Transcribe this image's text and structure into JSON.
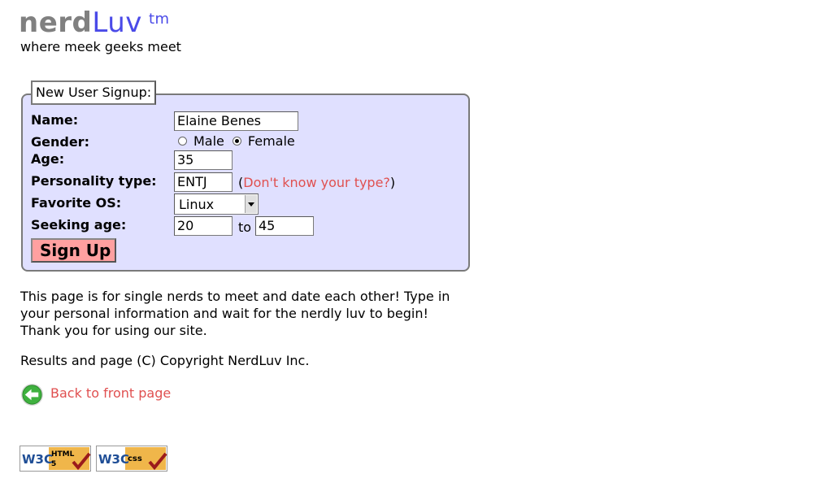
{
  "logo": {
    "nerd": "nerd",
    "luv": "Luv",
    "tm": "tm",
    "tagline": "where meek geeks meet"
  },
  "form": {
    "legend": "New User Signup:",
    "name_label": "Name:",
    "name_value": "Elaine Benes",
    "gender_label": "Gender:",
    "gender_male": "Male",
    "gender_female": "Female",
    "gender_selected": "Female",
    "age_label": "Age:",
    "age_value": "35",
    "personality_label": "Personality type:",
    "personality_value": "ENTJ",
    "personality_open": "(",
    "personality_link": "Don't know your type?",
    "personality_close": ")",
    "os_label": "Favorite OS:",
    "os_value": "Linux",
    "seeking_label": "Seeking age:",
    "seeking_min": "20",
    "seeking_to": "to",
    "seeking_max": "45",
    "submit_label": "Sign Up"
  },
  "content": {
    "para1_line1": "This page is for single nerds to meet and date each other! Type in",
    "para1_line2": "your personal information and wait for the nerdly luv to begin!",
    "para1_line3": "Thank you for using our site.",
    "copyright": "Results and page (C) Copyright NerdLuv Inc.",
    "back_link": "Back to front page"
  },
  "badges": {
    "html_w3c": "W3C",
    "html_label": "HTML",
    "html_version": "5",
    "css_w3c": "W3C",
    "css_label": "css"
  },
  "colors": {
    "fieldset_bg": "#e0e0ff",
    "logo_luv": "#4a4ae8",
    "link": "#e05050",
    "button_bg": "#ffa0a0"
  }
}
